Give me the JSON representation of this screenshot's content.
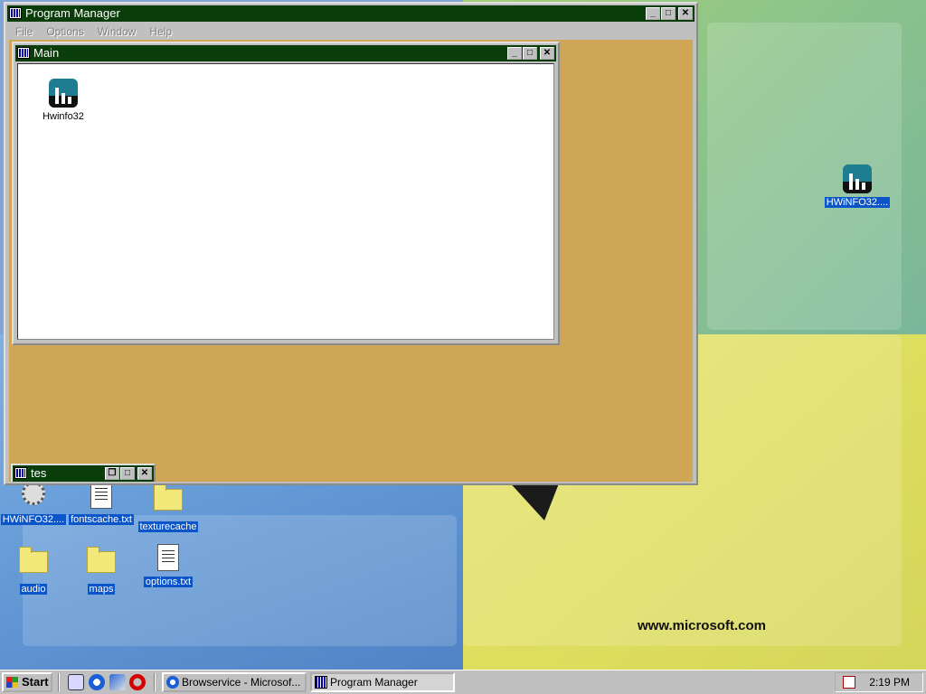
{
  "program_manager": {
    "title": "Program Manager",
    "menu": [
      "File",
      "Options",
      "Window",
      "Help"
    ],
    "main_window": {
      "title": "Main",
      "items": [
        {
          "label": "Hwinfo32",
          "icon": "hwinfo-icon"
        }
      ]
    },
    "minimized_group": {
      "title": "tes"
    }
  },
  "desktop": {
    "wallpaper_text": "www.microsoft.com",
    "icons": [
      {
        "label": "HWiNFO32....",
        "icon": "hwinfo-icon"
      },
      {
        "label": "HWiNFO32....",
        "icon": "gear-icon"
      },
      {
        "label": "fontscache.txt",
        "icon": "text-file-icon"
      },
      {
        "label": "texturecache",
        "icon": "folder-icon"
      },
      {
        "label": "audio",
        "icon": "folder-icon"
      },
      {
        "label": "maps",
        "icon": "folder-icon"
      },
      {
        "label": "options.txt",
        "icon": "text-file-icon"
      }
    ]
  },
  "taskbar": {
    "start_label": "Start",
    "quick_launch": [
      "show-desktop-icon",
      "internet-explorer-icon",
      "channels-icon",
      "opera-icon"
    ],
    "tasks": [
      {
        "label": "Browservice - Microsof...",
        "icon": "internet-explorer-icon",
        "active": false
      },
      {
        "label": "Program Manager",
        "icon": "program-manager-icon",
        "active": true
      }
    ],
    "clock": "2:19 PM"
  },
  "colors": {
    "titlebar": "#0b3d0b",
    "mdi_background": "#cfa556",
    "selection": "#0a55c9"
  }
}
